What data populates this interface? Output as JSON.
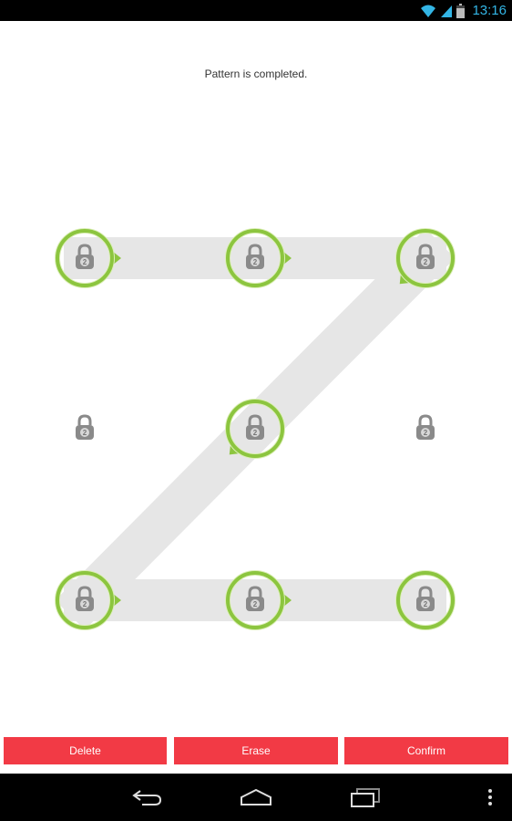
{
  "status_bar": {
    "time": "13:16",
    "icons": [
      "wifi-icon",
      "signal-icon",
      "battery-icon"
    ]
  },
  "pattern": {
    "message": "Pattern is completed.",
    "grid_size": 3,
    "nodes": [
      {
        "row": 0,
        "col": 0,
        "selected": true
      },
      {
        "row": 0,
        "col": 1,
        "selected": true
      },
      {
        "row": 0,
        "col": 2,
        "selected": true
      },
      {
        "row": 1,
        "col": 0,
        "selected": false
      },
      {
        "row": 1,
        "col": 1,
        "selected": true
      },
      {
        "row": 1,
        "col": 2,
        "selected": false
      },
      {
        "row": 2,
        "col": 0,
        "selected": true
      },
      {
        "row": 2,
        "col": 1,
        "selected": true
      },
      {
        "row": 2,
        "col": 2,
        "selected": true
      }
    ],
    "sequence": [
      0,
      1,
      2,
      4,
      6,
      7,
      8
    ],
    "lock_label": "2",
    "colors": {
      "ring": "#8cc53f",
      "path": "#e6e6e6",
      "lock": "#8a8a8a",
      "arrow": "#8cc53f"
    }
  },
  "buttons": {
    "delete": "Delete",
    "erase": "Erase",
    "confirm": "Confirm",
    "color": "#f23a45"
  },
  "nav_bar": {
    "icons": [
      "back-icon",
      "home-icon",
      "recent-apps-icon",
      "menu-icon"
    ]
  }
}
